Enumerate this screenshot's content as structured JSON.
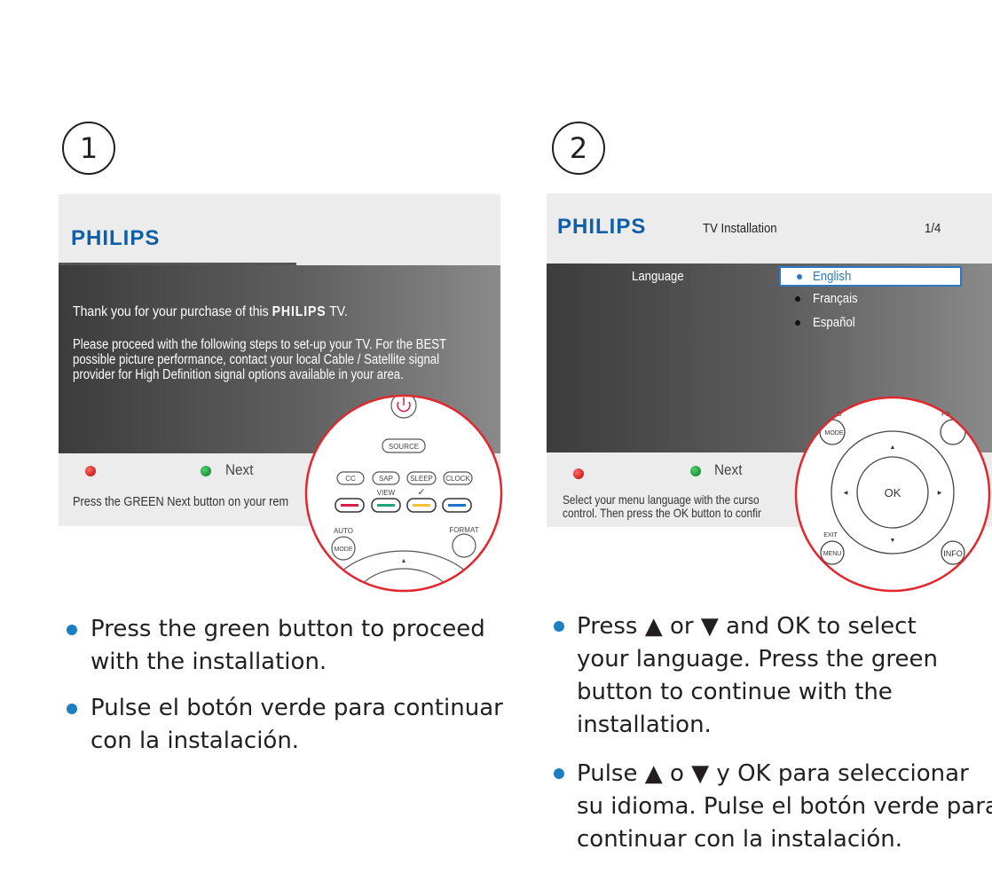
{
  "step1": {
    "number": "1",
    "logo": "PHILIPS",
    "thanks_prefix": "Thank you for your purchase of this ",
    "thanks_brand": "PHILIPS",
    "thanks_suffix": " TV.",
    "paragraph": [
      "Please proceed with the following steps to set-up your TV. For the BEST",
      "possible picture performance, contact your local Cable / Satellite signal",
      "provider for High Definition signal options available in your area."
    ],
    "next_label": "Next",
    "instruction": "Press the GREEN Next button on your rem",
    "remote": {
      "source": "SOURCE",
      "cc": "CC",
      "sap": "SAP",
      "sleep": "SLEEP",
      "clock": "CLOCK",
      "view": "VIEW",
      "check": "✓",
      "auto": "AUTO",
      "mode": "MODE",
      "format": "FORMAT",
      "up_arrow": "▲",
      "color_buttons": [
        "#d6204a",
        "#1fa37a",
        "#f2c230",
        "#1a73c8"
      ]
    },
    "bullets": [
      [
        "Press the green button to proceed",
        "with the installation."
      ],
      [
        "Pulse el botón verde para continuar",
        "con la instalación."
      ]
    ]
  },
  "step2": {
    "number": "2",
    "logo": "PHILIPS",
    "title": "TV Installation",
    "page": "1/4",
    "menu_label": "Language",
    "languages": [
      "English",
      "Français",
      "Español"
    ],
    "selected_language": "English",
    "next_label": "Next",
    "instruction": [
      "Select your menu language with the curso",
      "control. Then press the OK button to confir"
    ],
    "remote": {
      "ok": "OK",
      "mode": "MODE",
      "exit": "EXIT",
      "menu": "MENU",
      "info": "INFO",
      "auto_partial": "O",
      "format_partial": "FO",
      "up": "▲",
      "down": "▼",
      "left": "◀",
      "right": "▶"
    },
    "bullets": [
      [
        "Press ▲ or ▼ and OK to select",
        "your language. Press the green",
        "button to continue with the",
        "installation."
      ],
      [
        "Pulse ▲ o ▼ y OK para seleccionar",
        "su idioma. Pulse el botón verde para",
        "continuar con la instalación."
      ]
    ]
  },
  "colors": {
    "philips_blue": "#0e5fa8",
    "bullet_blue": "#1b7fc2",
    "highlight_red": "#e0282e",
    "selection_blue": "#2a79c7"
  }
}
